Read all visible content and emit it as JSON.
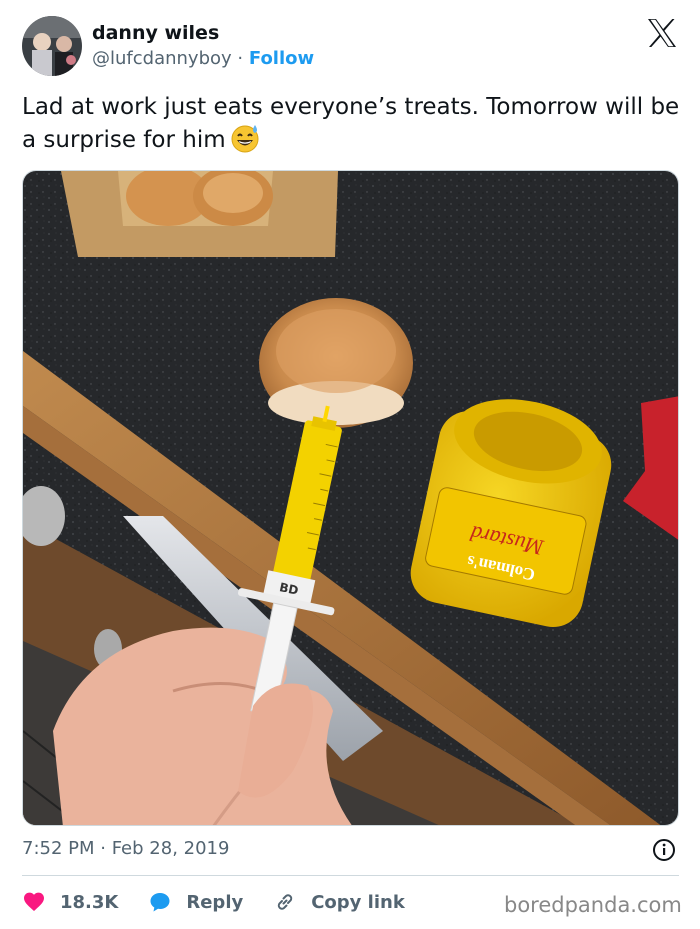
{
  "author": {
    "display_name": "danny wiles",
    "handle": "@lufcdannyboy",
    "separator": "·",
    "follow_label": "Follow"
  },
  "tweet": {
    "text": "Lad at work just eats everyone’s treats. Tomorrow will be a surprise for him",
    "emoji": "grinning-face-with-sweat-emoji",
    "timestamp": "7:52 PM · Feb 28, 2019"
  },
  "photo": {
    "syringe_label": "BD",
    "jar_label_brand": "Colman's",
    "jar_label_product": "Mustard"
  },
  "actions": {
    "likes": "18.3K",
    "reply_label": "Reply",
    "copy_link_label": "Copy link"
  },
  "watermark": "boredpanda.com",
  "colors": {
    "follow_blue": "#1d9bf0",
    "like_red": "#f91880",
    "reply_blue": "#1d9bf0",
    "muted_text": "#536471"
  }
}
